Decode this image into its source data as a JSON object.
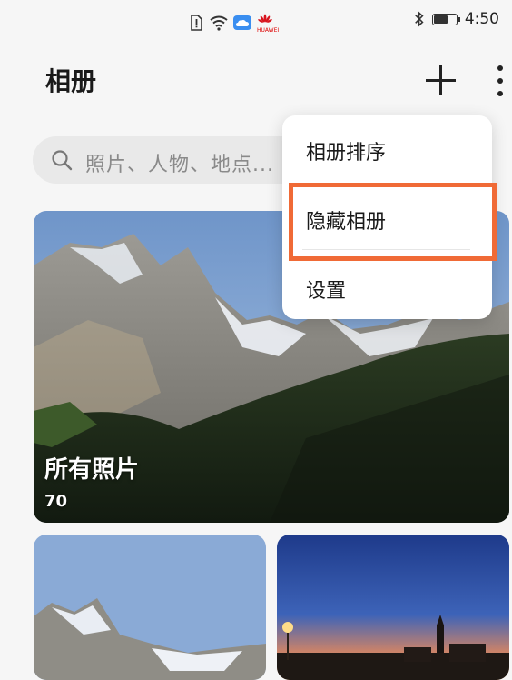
{
  "status_bar": {
    "time": "4:50",
    "carrier_mark": "HUAWEI",
    "icons": [
      "alert-sim-icon",
      "wifi-icon",
      "cloud-icon",
      "bluetooth-icon",
      "battery-icon"
    ],
    "battery_level": 0.7
  },
  "header": {
    "title": "相册",
    "add_icon": "plus-icon",
    "more_icon": "more-vertical-icon"
  },
  "search": {
    "placeholder": "照片、人物、地点...",
    "icon": "search-icon"
  },
  "albums": [
    {
      "name": "所有照片",
      "count": "70"
    },
    {
      "name": "",
      "count": ""
    },
    {
      "name": "",
      "count": ""
    }
  ],
  "menu": {
    "items": [
      "相册排序",
      "隐藏相册",
      "设置"
    ],
    "highlighted_index": 1,
    "highlight_color": "#f06a36"
  }
}
